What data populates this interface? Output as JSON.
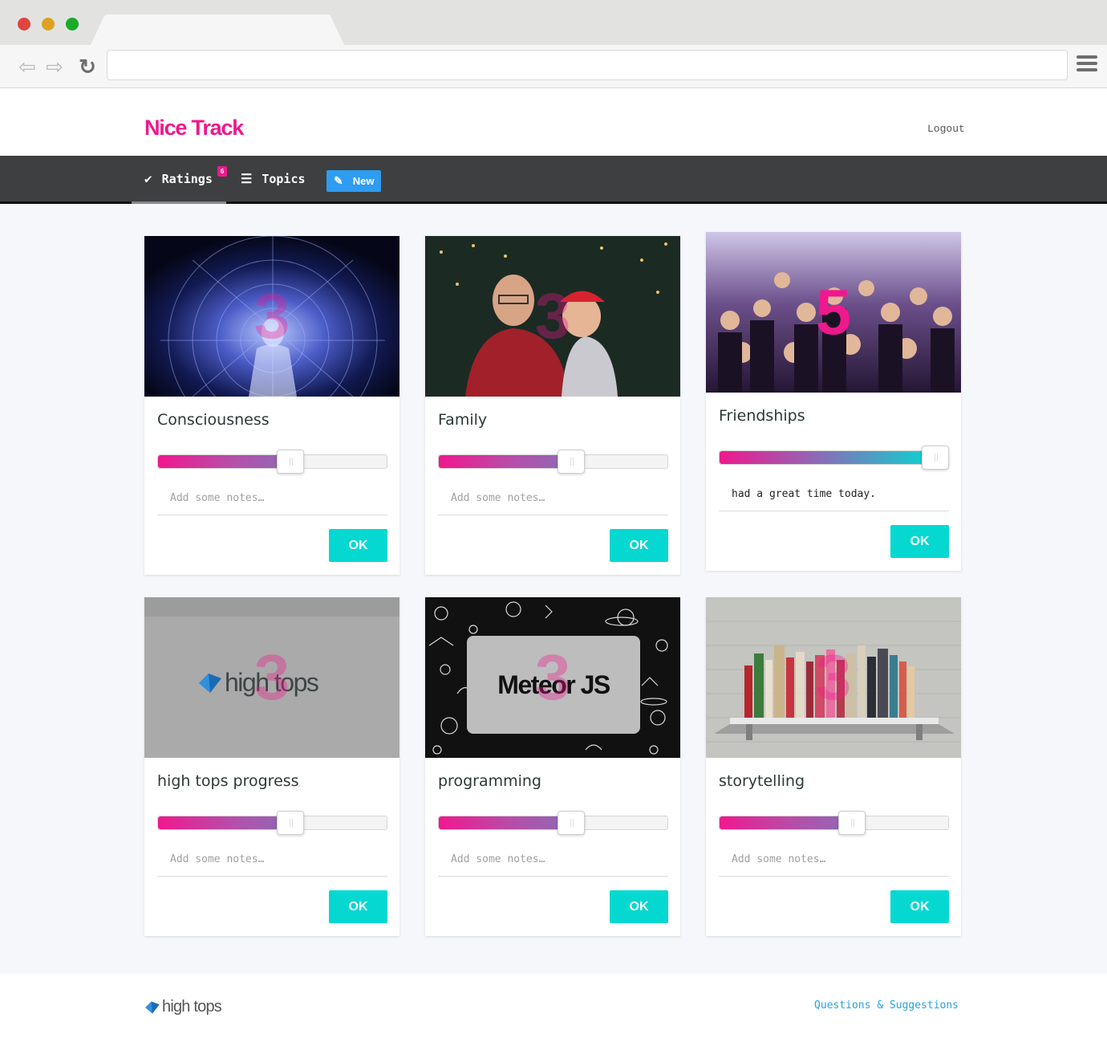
{
  "app": {
    "logo": "Nice Track",
    "logout_label": "Logout",
    "brand_color": "#f0188d",
    "accent_color": "#05d8d1"
  },
  "nav": {
    "ratings_label": "Ratings",
    "ratings_badge": "6",
    "topics_label": "Topics",
    "new_label": "New"
  },
  "cards": [
    {
      "title": "Consciousness",
      "score": "3",
      "rating_fraction": 0.59,
      "notes_placeholder": "Add some notes…",
      "notes_value": "",
      "ok_label": "OK",
      "image": "cosmic-body-illustration"
    },
    {
      "title": "Family",
      "score": "3",
      "rating_fraction": 0.59,
      "notes_placeholder": "Add some notes…",
      "notes_value": "",
      "ok_label": "OK",
      "image": "father-and-child-photo"
    },
    {
      "title": "Friendships",
      "score": "5",
      "rating_fraction": 1.0,
      "notes_placeholder": "Add some notes…",
      "notes_value": "had a great time today.",
      "ok_label": "OK",
      "image": "group-of-friends-photo"
    },
    {
      "title": "high tops progress",
      "score": "3",
      "rating_fraction": 0.59,
      "notes_placeholder": "Add some notes…",
      "notes_value": "",
      "ok_label": "OK",
      "image": "high-tops-logo",
      "image_text": "high tops"
    },
    {
      "title": "programming",
      "score": "3",
      "rating_fraction": 0.59,
      "notes_placeholder": "Add some notes…",
      "notes_value": "",
      "ok_label": "OK",
      "image": "meteor-js-logo",
      "image_text": "Meteor JS"
    },
    {
      "title": "storytelling",
      "score": "3",
      "rating_fraction": 0.59,
      "notes_placeholder": "Add some notes…",
      "notes_value": "",
      "ok_label": "OK",
      "image": "bookshelf-photo"
    }
  ],
  "footer": {
    "logo_text": "high tops",
    "link_label": "Questions & Suggestions"
  }
}
